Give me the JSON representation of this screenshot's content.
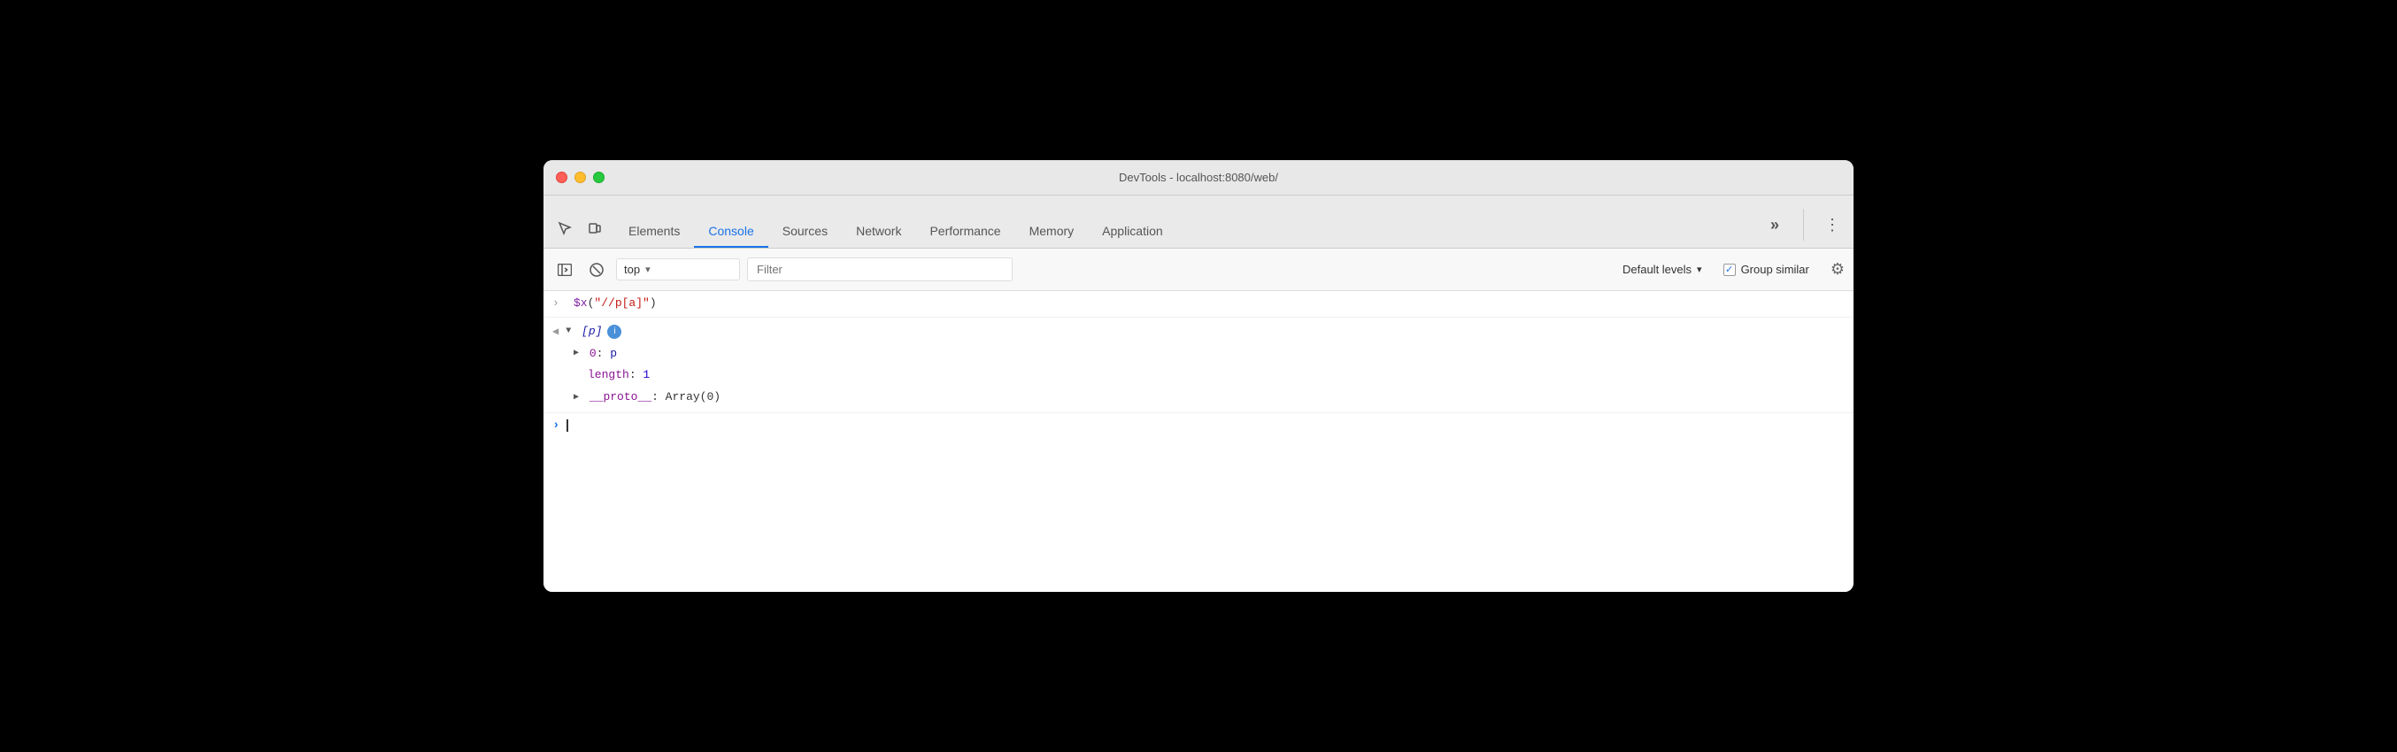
{
  "window": {
    "title": "DevTools - localhost:8080/web/"
  },
  "tabs": {
    "items": [
      {
        "id": "elements",
        "label": "Elements",
        "active": false
      },
      {
        "id": "console",
        "label": "Console",
        "active": true
      },
      {
        "id": "sources",
        "label": "Sources",
        "active": false
      },
      {
        "id": "network",
        "label": "Network",
        "active": false
      },
      {
        "id": "performance",
        "label": "Performance",
        "active": false
      },
      {
        "id": "memory",
        "label": "Memory",
        "active": false
      },
      {
        "id": "application",
        "label": "Application",
        "active": false
      }
    ]
  },
  "toolbar": {
    "context": "top",
    "context_dropdown_label": "▾",
    "filter_placeholder": "Filter",
    "levels_label": "Default levels",
    "group_similar_label": "Group similar"
  },
  "console_entries": [
    {
      "prompt": ">",
      "content": "$x(\"//p[a]\")"
    }
  ],
  "tree": {
    "array_label": "▼ [p]",
    "item_0_key": "0",
    "item_0_val": "p",
    "length_key": "length",
    "length_val": "1",
    "proto_key": "__proto__",
    "proto_val": "Array(0)"
  }
}
